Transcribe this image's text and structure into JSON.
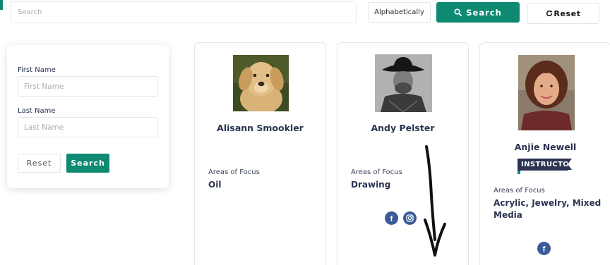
{
  "topbar": {
    "search_placeholder": "Search",
    "sort_value": "Alphabetically",
    "search_button": "Search",
    "reset_button": "Reset"
  },
  "filters": {
    "first_name_label": "First Name",
    "first_name_placeholder": "First Name",
    "last_name_label": "Last Name",
    "last_name_placeholder": "Last Name",
    "reset_button": "Reset",
    "search_button": "Search"
  },
  "cards": [
    {
      "name": "Alisann Smookler",
      "areas_label": "Areas of Focus",
      "areas": "Oil",
      "social": []
    },
    {
      "name": "Andy Pelster",
      "areas_label": "Areas of Focus",
      "areas": "Drawing",
      "social": [
        "facebook-icon",
        "instagram-icon"
      ]
    },
    {
      "name": "Anjie Newell",
      "badge": "INSTRUCTOR",
      "areas_label": "Areas of Focus",
      "areas": "Acrylic, Jewelry, Mixed Media",
      "social": [
        "facebook-icon"
      ]
    }
  ],
  "colors": {
    "accent": "#0e8a73",
    "text_navy": "#2b3452",
    "facebook": "#3b5a99"
  }
}
